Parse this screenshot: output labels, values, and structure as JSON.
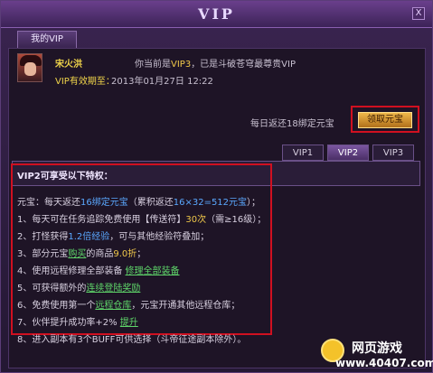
{
  "window": {
    "title": "VIP",
    "close_label": "X"
  },
  "tabs": {
    "my_vip": "我的VIP"
  },
  "player": {
    "name": "宋火洪",
    "vip_prefix": "你当前是",
    "vip_level": "VIP3",
    "vip_suffix": "，已是斗破苍穹最尊贵VIP",
    "expire_label": "VIP有效期至：",
    "expire_value": "2013年01月27日 12:22"
  },
  "daily": {
    "text": "每日返还18绑定元宝",
    "claim_button": "领取元宝"
  },
  "vip_tabs": [
    "VIP1",
    "VIP2",
    "VIP3"
  ],
  "privileges": {
    "title": "VIP2可享受以下特权：",
    "lines": [
      {
        "pre": "元宝：每天返还",
        "hl": "16绑定元宝",
        "mid": "（累积返还",
        "hl2": "16×32=512元宝",
        "post": "）；"
      },
      {
        "pre": "1、每天可在任务追踪免费使用【传送符】",
        "hl": "30次",
        "post": "（需≥16级）；"
      },
      {
        "pre": "2、打怪获得",
        "hl": "1.2倍经验",
        "post": "，可与其他经验符叠加；"
      },
      {
        "pre": "3、部分元宝",
        "hl": "购买",
        "mid": "的商品",
        "hl2": "9.0折",
        "post": "；"
      },
      {
        "pre": "4、使用远程修理全部装备  ",
        "link": "修理全部装备"
      },
      {
        "pre": "5、可获得额外的",
        "link": "连续登陆奖励"
      },
      {
        "pre": "6、免费使用第一个",
        "link": "远程仓库",
        "post": "，元宝开通其他远程仓库；"
      },
      {
        "pre": "7、伙伴提升成功率+2%    ",
        "link": "提升"
      },
      {
        "pre": "8、进入副本有3个BUFF可供选择（斗帝征途副本除外）。"
      }
    ]
  },
  "watermark": {
    "cn": "网页游戏",
    "url": "www.40407.com"
  },
  "colors": {
    "highlight": "#f0c84a",
    "link": "#5fd66a",
    "frame_red": "#d01020",
    "panel_bg": "#1e1426"
  }
}
